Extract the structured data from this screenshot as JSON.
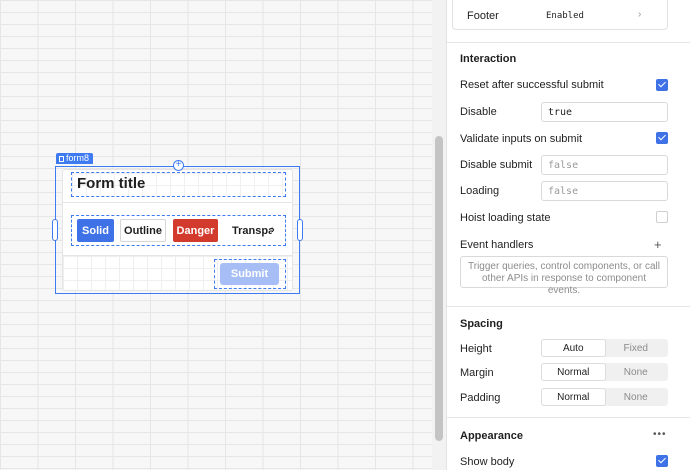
{
  "canvas": {
    "component_tag": "form8",
    "form": {
      "title": "Form title",
      "buttons": [
        {
          "label": "Solid"
        },
        {
          "label": "Outline"
        },
        {
          "label": "Danger"
        },
        {
          "label": "Transparent"
        }
      ],
      "submit_label": "Submit"
    }
  },
  "inspector": {
    "footer": {
      "label": "Footer",
      "value": "Enabled"
    },
    "interaction": {
      "title": "Interaction",
      "reset_after_submit": {
        "label": "Reset after successful submit",
        "checked": true
      },
      "disable": {
        "label": "Disable",
        "value": "true"
      },
      "validate_on_submit": {
        "label": "Validate inputs on submit",
        "checked": true
      },
      "disable_submit": {
        "label": "Disable submit",
        "placeholder": "false"
      },
      "loading": {
        "label": "Loading",
        "placeholder": "false"
      },
      "hoist_loading": {
        "label": "Hoist loading state",
        "checked": false
      },
      "event_handlers": {
        "label": "Event handlers",
        "placeholder": "Trigger queries, control components, or call other APIs in response to component events."
      }
    },
    "spacing": {
      "title": "Spacing",
      "height": {
        "label": "Height",
        "options": [
          "Auto",
          "Fixed"
        ],
        "selected": "Auto"
      },
      "margin": {
        "label": "Margin",
        "options": [
          "Normal",
          "None"
        ],
        "selected": "Normal"
      },
      "padding": {
        "label": "Padding",
        "options": [
          "Normal",
          "None"
        ],
        "selected": "Normal"
      }
    },
    "appearance": {
      "title": "Appearance",
      "show_body": {
        "label": "Show body",
        "checked": true
      }
    }
  },
  "icons": {
    "add": "plus-icon",
    "more": "more-horizontal-icon",
    "chevron": "chevron-right-icon",
    "check": "checkmark-icon"
  },
  "colors": {
    "accent": "#3e72e6",
    "danger": "#d23a2d",
    "submit_disabled": "#a6bdf6"
  }
}
